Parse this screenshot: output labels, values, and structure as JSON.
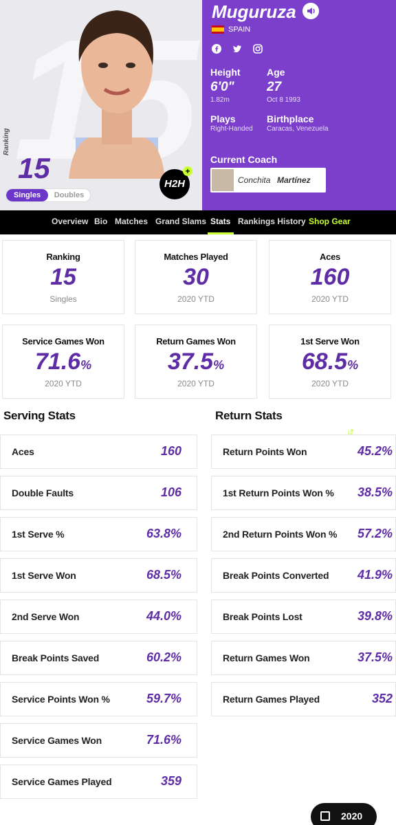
{
  "player": {
    "name": "Muguruza",
    "country": "SPAIN",
    "height_label": "Height",
    "height_value": "6'0\"",
    "height_metric": "1.82m",
    "age_label": "Age",
    "age_value": "27",
    "birth_date": "Oct 8 1993",
    "plays_label": "Plays",
    "plays_value": "Right-Handed",
    "birthplace_label": "Birthplace",
    "birthplace_value": "Caracas, Venezuela",
    "coach_label": "Current Coach",
    "coach_first": "Conchita",
    "coach_last": "Martínez",
    "ranking_vertical": "Ranking",
    "ranking_big": "15",
    "toggle_singles": "Singles",
    "toggle_doubles": "Doubles",
    "h2h_label": "H2H"
  },
  "nav": {
    "items": [
      "Overview",
      "Bio",
      "Matches",
      "Grand Slams",
      "Stats",
      "Rankings History",
      "Shop Gear"
    ],
    "active": "Stats"
  },
  "cards": [
    {
      "title": "Ranking",
      "value": "15",
      "pct": "",
      "sub": "Singles"
    },
    {
      "title": "Matches Played",
      "value": "30",
      "pct": "",
      "sub": "2020 YTD"
    },
    {
      "title": "Aces",
      "value": "160",
      "pct": "",
      "sub": "2020 YTD"
    },
    {
      "title": "Service Games Won",
      "value": "71.6",
      "pct": "%",
      "sub": "2020 YTD"
    },
    {
      "title": "Return Games Won",
      "value": "37.5",
      "pct": "%",
      "sub": "2020 YTD"
    },
    {
      "title": "1st Serve Won",
      "value": "68.5",
      "pct": "%",
      "sub": "2020 YTD"
    }
  ],
  "serving": {
    "title": "Serving Stats",
    "rows": [
      {
        "label": "Aces",
        "value": "160"
      },
      {
        "label": "Double Faults",
        "value": "106"
      },
      {
        "label": "1st Serve %",
        "value": "63.8%"
      },
      {
        "label": "1st Serve Won",
        "value": "68.5%"
      },
      {
        "label": "2nd Serve Won",
        "value": "44.0%"
      },
      {
        "label": "Break Points Saved",
        "value": "60.2%"
      },
      {
        "label": "Service Points Won %",
        "value": "59.7%"
      },
      {
        "label": "Service Games Won",
        "value": "71.6%"
      },
      {
        "label": "Service Games Played",
        "value": "359"
      }
    ]
  },
  "returns": {
    "title": "Return Stats",
    "rows": [
      {
        "label": "Return Points Won",
        "value": "45.2%"
      },
      {
        "label": "1st Return Points Won %",
        "value": "38.5%"
      },
      {
        "label": "2nd Return Points Won %",
        "value": "57.2%"
      },
      {
        "label": "Break Points Converted",
        "value": "41.9%"
      },
      {
        "label": "Break Points Lost",
        "value": "39.8%"
      },
      {
        "label": "Return Games Won",
        "value": "37.5%"
      },
      {
        "label": "Return Games Played",
        "value": "352"
      }
    ]
  },
  "year_selector": "2020",
  "colors": {
    "accent": "#5e2ca5",
    "hero_purple": "#7b3fcc",
    "nav_highlight": "#c8ff2e"
  }
}
